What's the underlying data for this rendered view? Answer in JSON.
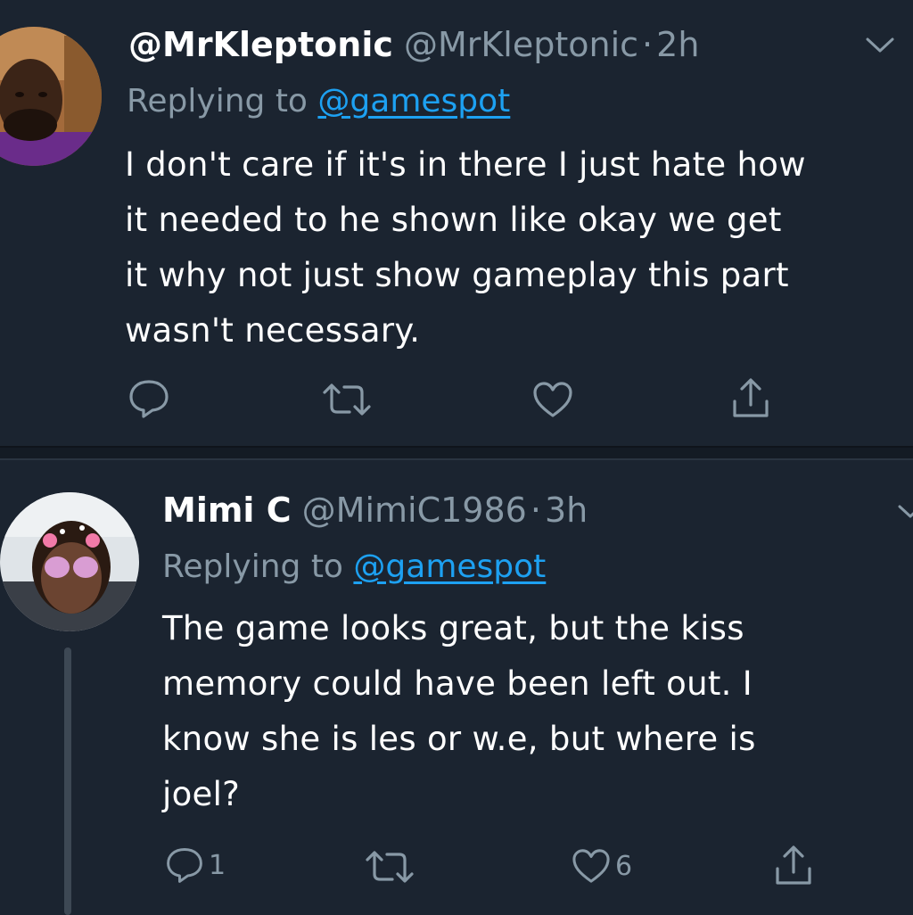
{
  "tweets": [
    {
      "display_name": "@MrKleptonic",
      "handle": "@MrKleptonic",
      "separator": "·",
      "time": "2h",
      "replying_prefix": "Replying to",
      "replying_to": "@gamespot",
      "body_lines": [
        "I don't care if it's in there I just hate how",
        "it needed to he shown like okay we get",
        "it why not just show gameplay  this part",
        "wasn't necessary."
      ],
      "reply_count": "",
      "retweet_count": "",
      "like_count": ""
    },
    {
      "display_name": "Mimi C",
      "handle": "@MimiC1986",
      "separator": "·",
      "time": "3h",
      "replying_prefix": "Replying to",
      "replying_to": "@gamespot",
      "body_lines": [
        "The game looks great, but the kiss",
        "memory could have been left out. I",
        "know she is les or w.e, but where is",
        "joel?"
      ],
      "reply_count": "1",
      "retweet_count": "",
      "like_count": "6"
    }
  ],
  "icons": {
    "reply": "reply-icon",
    "retweet": "retweet-icon",
    "like": "heart-icon",
    "share": "share-icon",
    "menu": "chevron-down-icon"
  },
  "colors": {
    "background": "#1b2430",
    "secondary_text": "#8899a6",
    "link": "#1da1f2"
  }
}
